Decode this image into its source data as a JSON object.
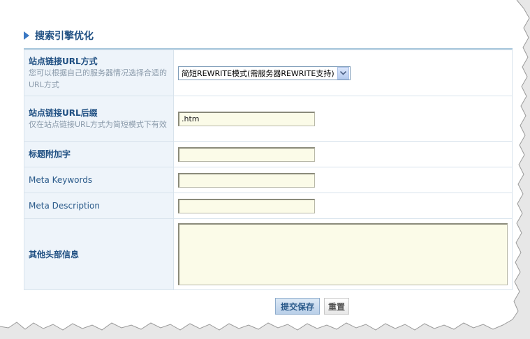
{
  "section": {
    "title": "搜索引擎优化"
  },
  "rows": {
    "url_mode": {
      "label": "站点链接URL方式",
      "hint": "您可以根据自己的服务器情况选择合适的URL方式",
      "selected": "简短REWRITE模式(需服务器REWRITE支持)"
    },
    "url_suffix": {
      "label": "站点链接URL后缀",
      "hint": "仅在站点链接URL方式为简短模式下有效",
      "value": ".htm"
    },
    "title_suffix": {
      "label": "标题附加字",
      "value": ""
    },
    "meta_keywords": {
      "label": "Meta Keywords",
      "value": ""
    },
    "meta_description": {
      "label": "Meta Description",
      "value": ""
    },
    "other_head": {
      "label": "其他头部信息",
      "value": ""
    }
  },
  "buttons": {
    "submit": "提交保存",
    "reset": "重置"
  },
  "colors": {
    "accent": "#1f4f82",
    "label_bg": "#eef4fa",
    "input_bg": "#fbfbe8"
  }
}
